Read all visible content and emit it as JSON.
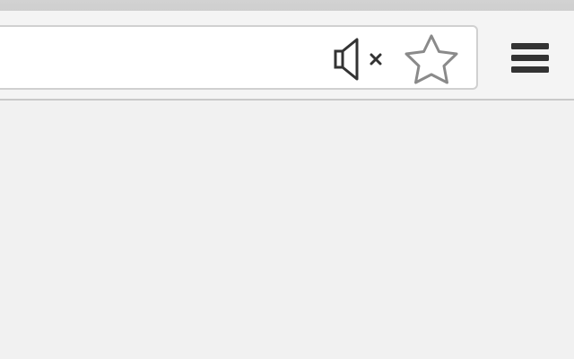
{
  "omnibox": {
    "value": "",
    "placeholder": ""
  },
  "icons": {
    "mute": "speaker-muted-icon",
    "bookmark": "star-outline-icon",
    "menu": "hamburger-menu-icon"
  },
  "colors": {
    "toolbar_bg": "#f4f4f4",
    "content_bg": "#f1f1f1",
    "icon_dark": "#333333",
    "star_outline": "#8a8a8a"
  }
}
